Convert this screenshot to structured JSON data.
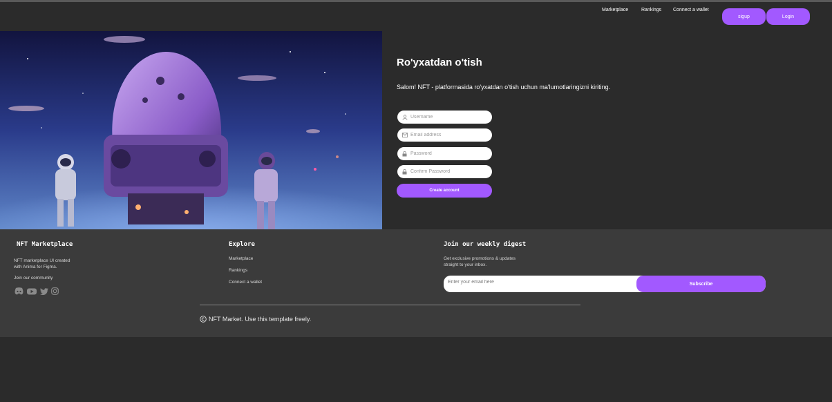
{
  "nav": {
    "links": [
      "Marketplace",
      "Rankings",
      "Connect a wallet"
    ],
    "signup_label": "sigup",
    "login_label": "Login"
  },
  "signup": {
    "title": "Ro'yxatdan o'tish",
    "subtitle": "Salom! NFT - platformasida ro'yxatdan o'tish uchun ma'lumotlaringizni kiriting.",
    "fields": [
      {
        "placeholder": "Username",
        "icon": "user-icon",
        "value": ""
      },
      {
        "placeholder": "Email address",
        "icon": "envelope-icon",
        "value": ""
      },
      {
        "placeholder": "Password",
        "icon": "lock-icon",
        "value": ""
      },
      {
        "placeholder": "Confirm Password",
        "icon": "lock-icon",
        "value": ""
      }
    ],
    "submit_label": "Create account"
  },
  "footer": {
    "brand": {
      "title": "NFT Marketplace",
      "desc_line1": "NFT marketplace UI created",
      "desc_line2": "with Anima for Figma.",
      "community": "Join our community",
      "socials": [
        "discord-icon",
        "youtube-icon",
        "twitter-icon",
        "instagram-icon"
      ]
    },
    "explore": {
      "title": "Explore",
      "links": [
        "Marketplace",
        "Rankings",
        "Connect a wallet"
      ]
    },
    "digest": {
      "title": "Join our weekly digest",
      "desc_line1": "Get exclusive promotions & updates",
      "desc_line2": "straight to your inbox.",
      "email_placeholder": "Enter your email here",
      "subscribe_label": "Subscribe"
    },
    "copyright": "NFT Market. Use this template freely."
  },
  "colors": {
    "accent": "#a259ff",
    "background": "#2b2b2b",
    "footer": "#3b3b3b"
  }
}
